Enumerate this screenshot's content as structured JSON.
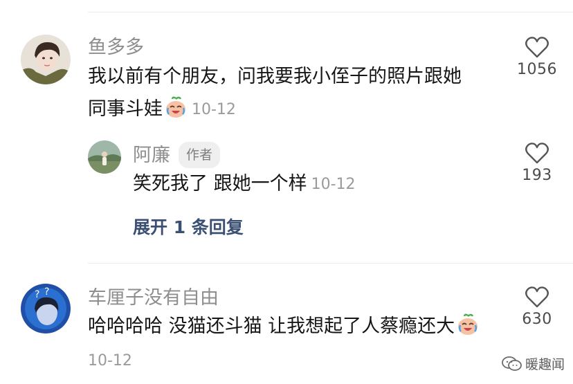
{
  "comments": [
    {
      "username": "鱼多多",
      "text_line1": "我以前有个朋友，问我要我小侄子的照片跟她",
      "text_line2": "同事斗娃",
      "emoji": "crying-laughing-peach-emoji",
      "date": "10-12",
      "likes": "1056",
      "replies": [
        {
          "username": "阿廉",
          "badge": "作者",
          "text": "笑死我了 跟她一个样",
          "date": "10-12",
          "likes": "193"
        }
      ],
      "expand_label": "展开 1 条回复"
    },
    {
      "username": "车厘子没有自由",
      "text": "哈哈哈哈 没猫还斗猫 让我想起了人蔡瘾还大",
      "emoji": "crying-laughing-peach-emoji",
      "date": "10-12",
      "likes": "630"
    }
  ],
  "watermark": "暖趣闻",
  "icons": {
    "like": "heart-outline-icon",
    "watermark": "wechat-icon"
  },
  "colors": {
    "username": "#8e8e8e",
    "text": "#161616",
    "date": "#9a9a9a",
    "expand_link": "#3a4f72",
    "badge_bg": "#efefef"
  }
}
